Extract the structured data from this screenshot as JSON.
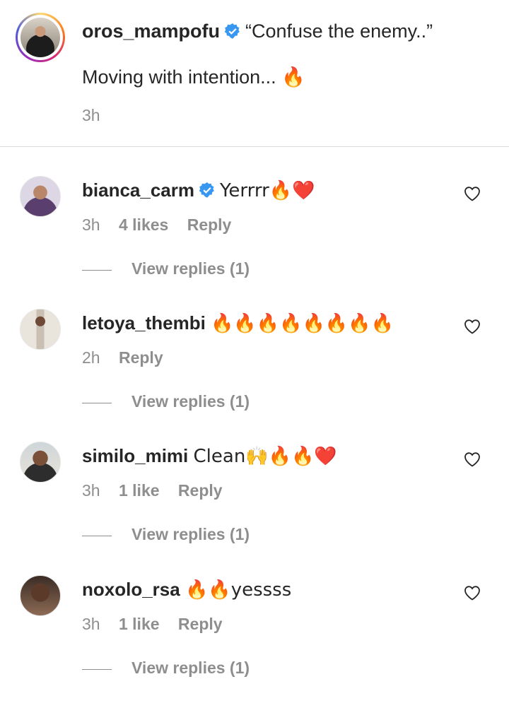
{
  "caption": {
    "username": "oros_mampofu",
    "quote": "“Confuse the enemy..”",
    "body": "Moving with intention...",
    "body_emoji": "🔥",
    "time": "3h"
  },
  "comments": [
    {
      "username": "bianca_carm",
      "verified": true,
      "text": "Yerrrr🔥❤️",
      "time": "3h",
      "likes": "4 likes",
      "reply": "Reply",
      "view_replies": "View replies (1)"
    },
    {
      "username": "letoya_thembi",
      "verified": false,
      "text": "🔥🔥🔥🔥🔥🔥🔥🔥",
      "time": "2h",
      "likes": "",
      "reply": "Reply",
      "view_replies": "View replies (1)"
    },
    {
      "username": "similo_mimi",
      "verified": false,
      "text": "Clean🙌🔥🔥❤️",
      "time": "3h",
      "likes": "1 like",
      "reply": "Reply",
      "view_replies": "View replies (1)"
    },
    {
      "username": "noxolo_rsa",
      "verified": false,
      "text": "🔥🔥yessss",
      "time": "3h",
      "likes": "1 like",
      "reply": "Reply",
      "view_replies": "View replies (1)"
    }
  ],
  "colors": {
    "verified": "#3897f0",
    "muted": "#8e8e8e",
    "divider": "#dbdbdb",
    "text": "#262626"
  },
  "icons": {
    "heart": "heart-outline-icon",
    "verified": "verified-badge-icon"
  }
}
